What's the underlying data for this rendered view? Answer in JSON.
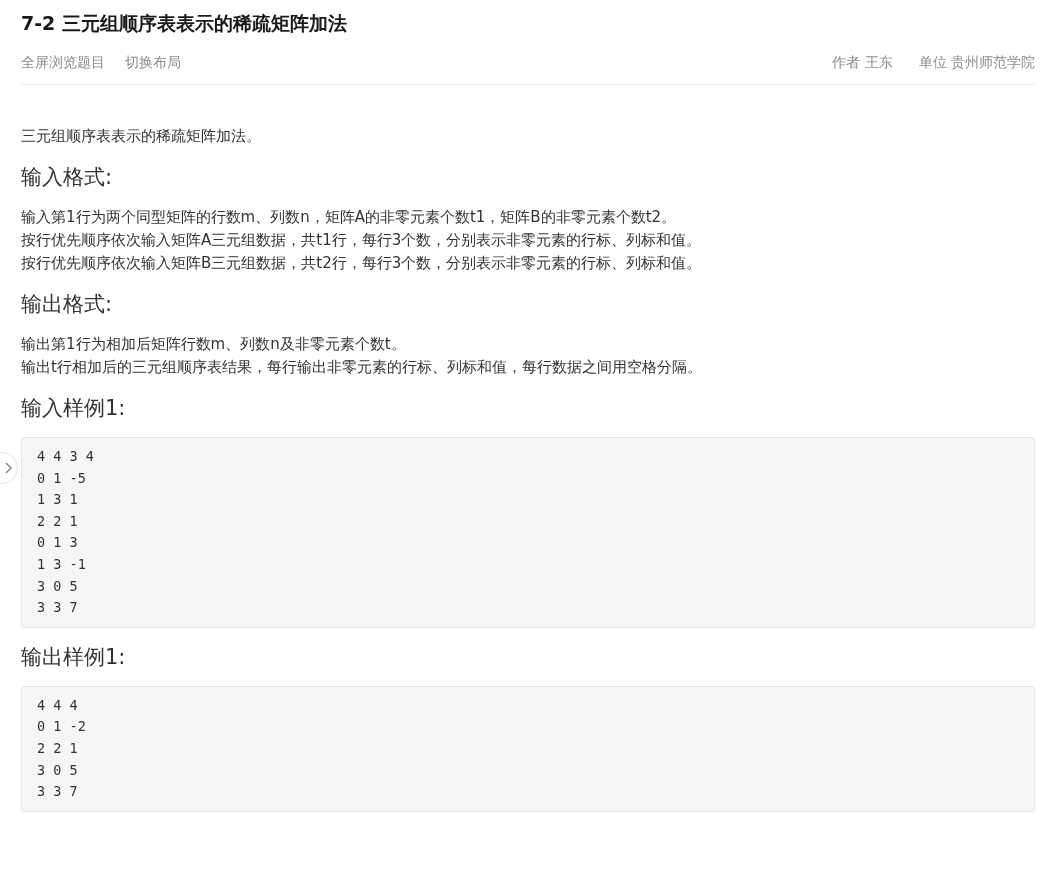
{
  "title": "7-2 三元组顺序表表示的稀疏矩阵加法",
  "toolbar": {
    "links": [
      "全屏浏览题目",
      "切换布局"
    ],
    "meta": [
      {
        "label": "作者",
        "value": "王东"
      },
      {
        "label": "单位",
        "value": "贵州师范学院"
      }
    ]
  },
  "sections": [
    {
      "kind": "text",
      "lines": [
        "三元组顺序表表示的稀疏矩阵加法。"
      ]
    },
    {
      "kind": "heading",
      "text": "输入格式:"
    },
    {
      "kind": "text",
      "lines": [
        "输入第1行为两个同型矩阵的行数m、列数n，矩阵A的非零元素个数t1，矩阵B的非零元素个数t2。",
        "按行优先顺序依次输入矩阵A三元组数据，共t1行，每行3个数，分别表示非零元素的行标、列标和值。",
        "按行优先顺序依次输入矩阵B三元组数据，共t2行，每行3个数，分别表示非零元素的行标、列标和值。"
      ]
    },
    {
      "kind": "heading",
      "text": "输出格式:"
    },
    {
      "kind": "text",
      "lines": [
        "输出第1行为相加后矩阵行数m、列数n及非零元素个数t。",
        "输出t行相加后的三元组顺序表结果，每行输出非零元素的行标、列标和值，每行数据之间用空格分隔。"
      ]
    },
    {
      "kind": "heading",
      "text": "输入样例1:"
    },
    {
      "kind": "code",
      "lines": [
        "4 4 3 4",
        "0 1 -5",
        "1 3 1",
        "2 2 1",
        "0 1 3",
        "1 3 -1",
        "3 0 5",
        "3 3 7"
      ]
    },
    {
      "kind": "heading",
      "text": "输出样例1:"
    },
    {
      "kind": "code",
      "lines": [
        "4 4 4",
        "0 1 -2",
        "2 2 1",
        "3 0 5",
        "3 3 7"
      ]
    }
  ]
}
